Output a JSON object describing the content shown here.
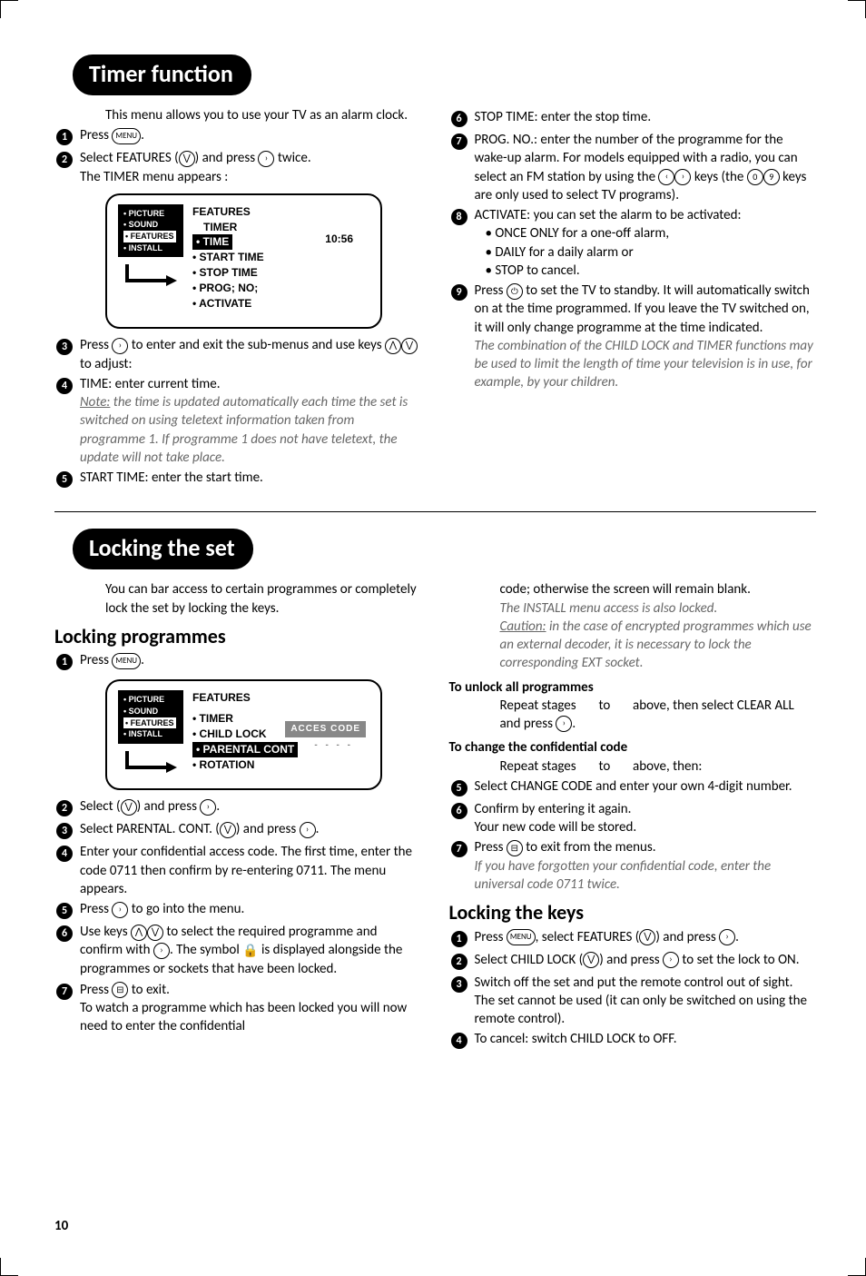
{
  "sections": {
    "timer_title": "Timer function",
    "lock_title": "Locking the set"
  },
  "timer": {
    "intro": "This menu allows you to use your TV as an alarm clock.",
    "s1": "Press ",
    "s1_key": "MENU",
    "s1_end": ".",
    "s2a": "Select FEATURES (",
    "s2b": ") and press ",
    "s2c": " twice.",
    "s2d": "The TIMER menu appears :",
    "tv": {
      "left": [
        "• PICTURE",
        "• SOUND",
        "• FEATURES",
        "• INSTALL"
      ],
      "left_hl_index": 2,
      "r_title": "FEATURES",
      "r_sub": "TIMER",
      "r_items": [
        "• TIME",
        "• START TIME",
        "• STOP TIME",
        "• PROG; NO;",
        "• ACTIVATE"
      ],
      "r_hl_index": 0,
      "time": "10:56"
    },
    "s3a": "Press ",
    "s3b": " to enter and exit the sub-menus and use keys ",
    "s3c": " to adjust:",
    "s4": "TIME: enter current time.",
    "s4_note": "Note: the time is updated automatically each time the set is switched on using teletext information taken from programme 1. If programme 1 does not have teletext, the update will not take place.",
    "s4_note_label": "Note:",
    "s5": "START TIME: enter the start time.",
    "s6": "STOP TIME: enter the stop time.",
    "s7": "PROG. NO.: enter the number of the programme for the wake-up alarm. For models equipped with a radio, you can select an FM station by using the ",
    "s7b": " keys (the ",
    "s7c": " keys are only used to select TV programs).",
    "s8": "ACTIVATE: you can set the alarm to be activated:",
    "s8a": "• ONCE ONLY for a one-off alarm,",
    "s8b": "• DAILY for a daily alarm or",
    "s8c": "• STOP to cancel.",
    "s9a": "Press ",
    "s9b": " to set the TV to standby. It will automatically switch on at the time programmed. If you leave the TV switched on, it will only change programme at the time indicated.",
    "s9_note": "The combination of the CHILD LOCK and TIMER functions may be used to limit the length of time your television is in use, for example, by your children."
  },
  "lock": {
    "intro": "You can bar access to certain programmes or completely lock the set by locking the keys.",
    "h_prog": "Locking programmes",
    "s1": "Press ",
    "s1_key": "MENU",
    "s1_end": ".",
    "tv": {
      "left": [
        "• PICTURE",
        "• SOUND",
        "• FEATURES",
        "• INSTALL"
      ],
      "left_hl_index": 2,
      "r_title": "FEATURES",
      "r_items": [
        "• TIMER",
        "• CHILD LOCK",
        "• PARENTAL CONT",
        "• ROTATION"
      ],
      "r_hl_index": 2,
      "access": "ACCES CODE",
      "dash": "- - - -"
    },
    "s2a": "Select   (",
    "s2b": ") and press ",
    "s2c": ".",
    "s3a": "Select PARENTAL. CONT. (",
    "s3b": ") and press ",
    "s3c": ".",
    "s4": "Enter your confidential access code. The first time, enter the code 0711 then confirm by re-entering 0711. The menu appears.",
    "s5a": "Press ",
    "s5b": " to go into the menu.",
    "s6a": "Use keys ",
    "s6b": " to select the required programme and confirm with ",
    "s6c": ". The symbol ",
    "s6d": " is displayed alongside the programmes or sockets that have been locked.",
    "s7a": "Press ",
    "s7b": " to exit.",
    "s7_text": "To watch a programme which has been locked you will now need to enter the confidential",
    "right_continue": "code; otherwise the screen will remain blank.",
    "right_note": "The INSTALL menu access is also locked.",
    "right_caution_label": "Caution:",
    "right_caution": " in the case of encrypted programmes which use an external decoder, it is necessary to lock the corresponding EXT socket.",
    "unlock_h": "To unlock all programmes",
    "unlock_a": "Repeat stages ",
    "unlock_b": " to ",
    "unlock_c": " above, then select CLEAR ALL and press ",
    "unlock_d": ".",
    "change_h": "To change the confidential code",
    "change_a": "Repeat stages ",
    "change_b": " to ",
    "change_c": " above, then:",
    "c5": "Select CHANGE CODE and enter your own 4-digit number.",
    "c6": "Confirm by entering it again.",
    "c6b": "Your new code will be stored.",
    "c7a": "Press ",
    "c7b": " to exit from the menus.",
    "c7_note": "If you have forgotten your confidential code, enter the universal code 0711 twice.",
    "h_keys": "Locking the keys",
    "k1a": "Press ",
    "k1b": ", select FEATURES (",
    "k1c": ") and press ",
    "k1d": ".",
    "k2a": "Select CHILD LOCK (",
    "k2b": ") and press ",
    "k2c": " to set the lock to ON.",
    "k3": "Switch off the set and put the remote control out of sight. The set cannot be used (it can only be switched on using the remote control).",
    "k4": "To cancel: switch CHILD LOCK to OFF."
  },
  "pagenum": "10"
}
